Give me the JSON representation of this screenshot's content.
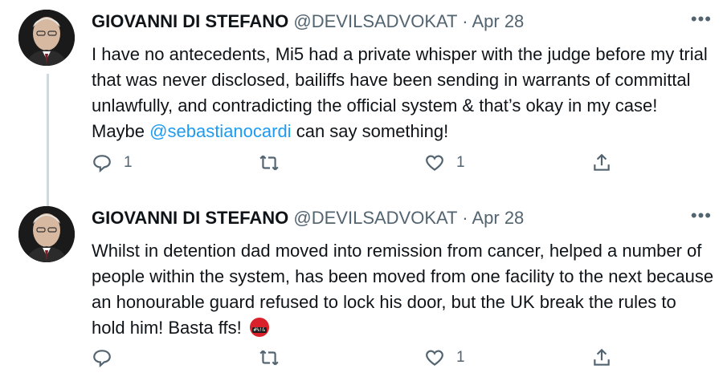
{
  "tweets": [
    {
      "name": "GIOVANNI DI STEFANO",
      "handle": "@DEVILSADVOKAT",
      "separator": "·",
      "date": "Apr 28",
      "more": "•••",
      "text_before": "I have no antecedents, Mi5 had a private whisper with the judge before my trial that was never disclosed, bailiffs have been sending in warrants of committal unlawfully, and contradicting the official system & that’s okay in my case! Maybe ",
      "mention": "@sebastianocardi",
      "text_after": " can say something!",
      "reply_count": "1",
      "retweet_count": "",
      "like_count": "1"
    },
    {
      "name": "GIOVANNI DI STEFANO",
      "handle": "@DEVILSADVOKAT",
      "separator": "·",
      "date": "Apr 28",
      "more": "•••",
      "text": "Whilst in detention dad moved into remission from cancer, helped a number of people within the system, has been moved from one facility to the next because an honourable guard refused to lock his door, but the UK break the rules to hold him! Basta ffs!",
      "emoji_name": "face-with-symbols-on-mouth",
      "emoji_symbols": "#%!&",
      "reply_count": "",
      "retweet_count": "",
      "like_count": "1"
    }
  ],
  "colors": {
    "text": "#0f1419",
    "secondary": "#536471",
    "link": "#1d9bf0",
    "thread_line": "#cfd9de"
  },
  "icons": [
    "avatar",
    "more-icon",
    "reply-icon",
    "retweet-icon",
    "like-icon",
    "share-icon"
  ]
}
